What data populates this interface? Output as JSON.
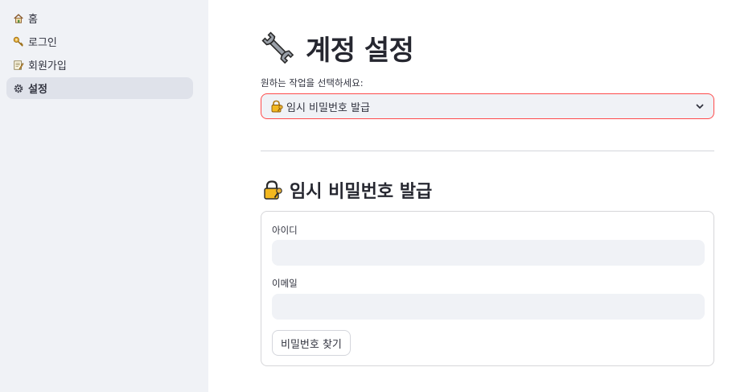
{
  "sidebar": {
    "items": [
      {
        "label": "홈",
        "icon": "house-icon",
        "active": false
      },
      {
        "label": "로그인",
        "icon": "key-icon",
        "active": false
      },
      {
        "label": "회원가입",
        "icon": "memo-icon",
        "active": false
      },
      {
        "label": "설정",
        "icon": "gear-icon",
        "active": true
      }
    ]
  },
  "main": {
    "title": "계정 설정",
    "title_icon": "wrench-icon",
    "select": {
      "label": "원하는 작업을 선택하세요:",
      "value": "임시 비밀번호 발급",
      "value_icon": "lock-key-icon"
    },
    "section": {
      "title": "임시 비밀번호 발급",
      "icon": "lock-key-icon"
    },
    "form": {
      "id_label": "아이디",
      "id_value": "",
      "email_label": "이메일",
      "email_value": "",
      "submit_label": "비밀번호 찾기"
    }
  },
  "colors": {
    "sidebar_bg": "#f0f2f6",
    "active_item_bg": "#dfe2ea",
    "accent": "#ff4b4b",
    "input_bg": "#f0f2f6",
    "text": "#31333f"
  }
}
